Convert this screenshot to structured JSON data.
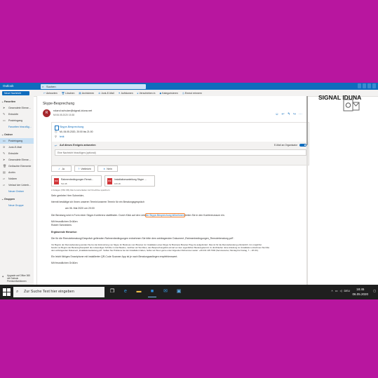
{
  "app": {
    "title": "Outlook",
    "search_placeholder": "Suchen"
  },
  "brand_logo": "SIGNAL IDUNA",
  "toolbar": {
    "new_mail": "Neue Nachricht",
    "items": [
      "Antworten",
      "Löschen",
      "Archivieren",
      "Junk-E-Mail",
      "Aufräumen",
      "Verschieben in",
      "Kategorisieren",
      "Erneut erinnern"
    ]
  },
  "sidebar": {
    "favorites_header": "Favoriten",
    "favorites": [
      "Gesendete Eleme...",
      "Entwürfe",
      "Posteingang",
      "Favoriten hinzufüg..."
    ],
    "folders_header": "Ordner",
    "folders": [
      "Posteingang",
      "Junk-E-Mail",
      "Entwürfe",
      "Gesendete Eleme...",
      "Gelöschte Elemente",
      "Archiv",
      "Notizen",
      "Verlauf der Unterh..."
    ],
    "new_folder": "Neuer Ordner",
    "groups_header": "Gruppen",
    "new_group": "Neue Gruppe",
    "upgrade_text": "Upgrade auf Office 365 mit Outlook Premiumfunktionen"
  },
  "message": {
    "subject": "Skype-Besprechung",
    "avatar": "R",
    "from": "roland.schulze@signal-iduna.net",
    "date": "Mi 06.05.2020 15:38",
    "event_title": "Skype-Besprechung",
    "event_when": "Mi, 06.05.2020, 20:00 bis 21:00",
    "event_where": "fehlt",
    "respond_label": "Auf dieses Ereignis antworten",
    "email_to_organizer": "E-Mail an Organisator",
    "note_placeholder": "Eine Nachricht hinzufügen (optional)",
    "buttons": [
      {
        "icon": "✓",
        "label": "Ja"
      },
      {
        "icon": "?",
        "label": "Vielleicht"
      },
      {
        "icon": "✕",
        "label": "Nein"
      }
    ],
    "attachments": [
      {
        "name": "Rahmenbedingungen Remot...",
        "size": "511 kB"
      },
      {
        "name": "Installationsanleitung Skype ...",
        "size": "166 kB"
      }
    ],
    "attachment_info": "2 Anlagen (581 KB)   Alle herunterladen   Auf OneDrive speichern",
    "body": {
      "greeting": "Sehr geehrter Herr Schneider,",
      "line1": "hiermit bestätige ich Ihnen unseren Termin/unseren Termin für ein Beratungsgespräch",
      "date_line": "am 06. Mai 2020      um 20:00",
      "line2_a": "Die Beratung wird in Form einer Skype-Konferenz stattfinden. Durch Klick auf den Link ",
      "link": "An Skype-Besprechung teilnehmen",
      "line2_b": " treten Sie in den Konferenzraum ein.",
      "regards": "Mit freundlichen Grüßen",
      "signer": "Robert Schneiders",
      "heading": "Ergänzende Hinweise:",
      "p1": "Die für die Remoteberatung/Gespräch geltenden Rahmenbedingungen entnehmen Sie bitte dem anhängenden Dokument „Rahmenbedingungen_Remoteberatung.pdf“.",
      "p2a": "Vor Beginn der Remoteberatung werden Sie bei der Erstnutzung von Skype for Business vom Browser zur Installation eines Skype for Business Browser Plug-Ins aufgefordert. Dies ist für die Remoteberatung erforderlich. Um möglichst",
      "p2b": "bereits vor Beginn der Beratung/Gespräch die notwendigen Schritte zu durchlaufen, möchten wir Sie bitten, den Besprechungslink einmal vor dem eigentlichen Beratungstermin zu durchlaufen. Eine Anleitung zur Installation entnehmen Sie bitte",
      "p2c": "dem anhängenden Dokument „Installationsanleitung.pdf“. Sollten Sie Probleme bei der Installation haben, helfen wir Ihnen gerne unter folgender Rufnummer weiter: +49 231 135 7000 (Servicecenter, Montag bis Freitag, 7 – 18 Uhr).",
      "p3": "Ein leicht fähiges Smartphone mit installierter QR-Code Scanner App ist je nach Beratungsanliegen empfehlenswert.",
      "closing": "Mit freundlichen Grüßen"
    }
  },
  "taskbar": {
    "search_placeholder": "Zur Suche Text hier eingeben",
    "language": "DEU",
    "time": "18:45",
    "date": "06.05.2020"
  },
  "colors": {
    "background": "#b8169f",
    "accent": "#0f6cbd",
    "highlight": "#f2802f"
  }
}
